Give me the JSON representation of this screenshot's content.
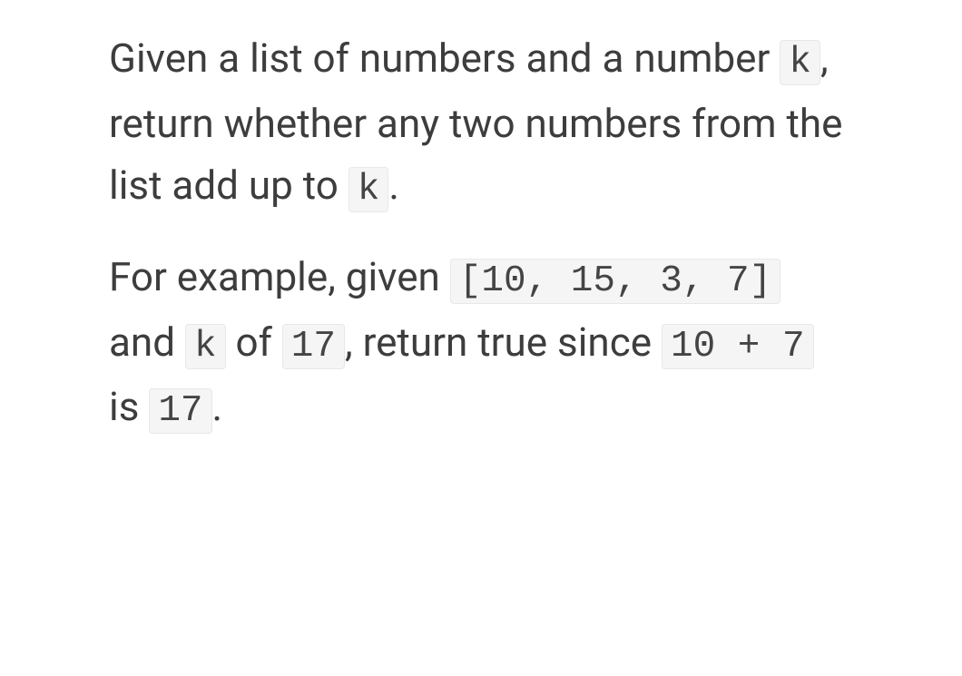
{
  "para1": {
    "t1": "Given a list of numbers and a number ",
    "c1": "k",
    "t2": ", return whether any two numbers from the list add up to ",
    "c2": "k",
    "t3": "."
  },
  "para2": {
    "t1": "For example, given ",
    "c1": "[10, 15, 3, 7]",
    "t2": " and ",
    "c2": "k",
    "t3": " of ",
    "c3": "17",
    "t4": ", return true since ",
    "c4": "10 + 7",
    "t5": " is ",
    "c5": "17",
    "t6": "."
  }
}
